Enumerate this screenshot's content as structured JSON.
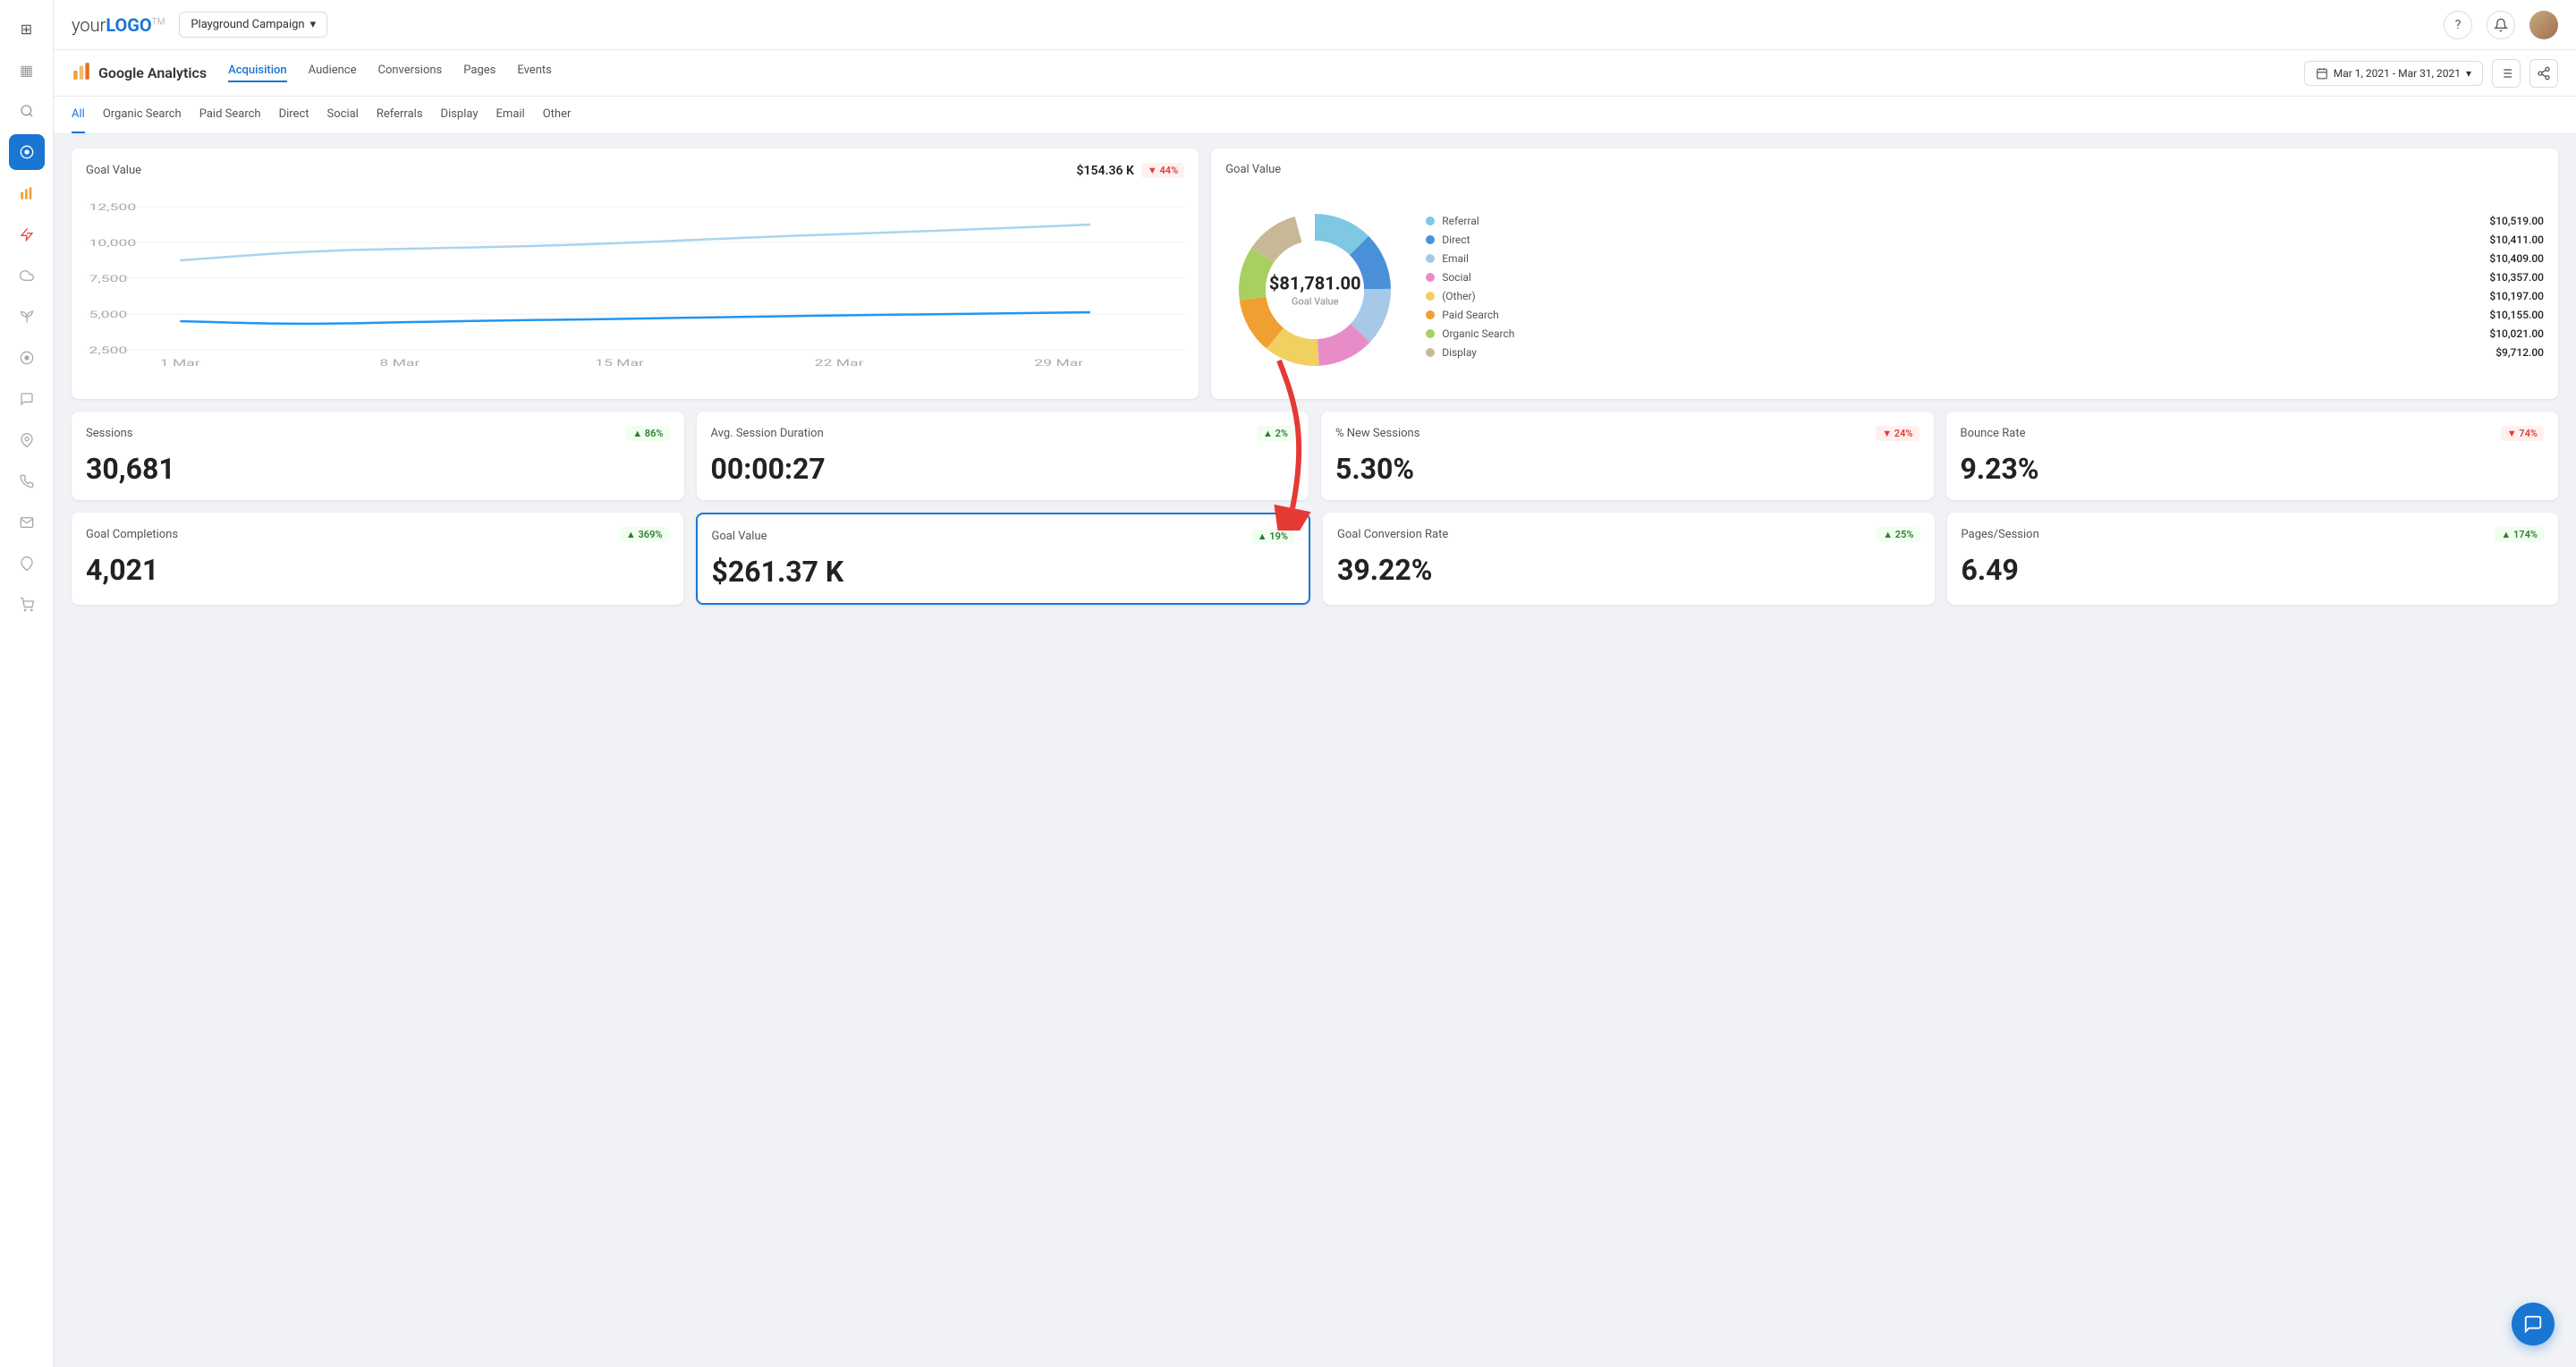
{
  "logo": {
    "text_plain": "your",
    "text_bold": "LOGO",
    "tm": "TM"
  },
  "header": {
    "campaign_label": "Playground Campaign",
    "campaign_dropdown_icon": "▾",
    "help_icon": "?",
    "notification_icon": "🔔",
    "date_range": "Mar 1, 2021 - Mar 31, 2021"
  },
  "ga": {
    "title": "Google Analytics",
    "tabs": [
      {
        "label": "Acquisition",
        "active": true
      },
      {
        "label": "Audience",
        "active": false
      },
      {
        "label": "Conversions",
        "active": false
      },
      {
        "label": "Pages",
        "active": false
      },
      {
        "label": "Events",
        "active": false
      }
    ]
  },
  "channel_tabs": [
    {
      "label": "All",
      "active": true
    },
    {
      "label": "Organic Search",
      "active": false
    },
    {
      "label": "Paid Search",
      "active": false
    },
    {
      "label": "Direct",
      "active": false
    },
    {
      "label": "Social",
      "active": false
    },
    {
      "label": "Referrals",
      "active": false
    },
    {
      "label": "Display",
      "active": false
    },
    {
      "label": "Email",
      "active": false
    },
    {
      "label": "Other",
      "active": false
    }
  ],
  "goal_value_chart": {
    "title": "Goal Value",
    "value": "$154.36 K",
    "badge": "▼ 44%",
    "badge_type": "red",
    "x_labels": [
      "1 Mar",
      "8 Mar",
      "15 Mar",
      "22 Mar",
      "29 Mar"
    ],
    "y_labels": [
      "12,500",
      "10,000",
      "7,500",
      "5,000",
      "2,500"
    ]
  },
  "donut_chart": {
    "title": "Goal Value",
    "center_value": "$81,781.00",
    "center_label": "Goal Value",
    "legend": [
      {
        "name": "Referral",
        "value": "$10,519.00",
        "color": "#7ec8e3"
      },
      {
        "name": "Direct",
        "value": "$10,411.00",
        "color": "#4a90d9"
      },
      {
        "name": "Email",
        "value": "$10,409.00",
        "color": "#a8c8e8"
      },
      {
        "name": "Social",
        "value": "$10,357.00",
        "color": "#e88cc8"
      },
      {
        "name": "(Other)",
        "value": "$10,197.00",
        "color": "#f0d060"
      },
      {
        "name": "Paid Search",
        "value": "$10,155.00",
        "color": "#f0a030"
      },
      {
        "name": "Organic Search",
        "value": "$10,021.00",
        "color": "#a8d060"
      },
      {
        "name": "Display",
        "value": "$9,712.00",
        "color": "#c8b898"
      }
    ]
  },
  "metrics": [
    {
      "label": "Sessions",
      "value": "30,681",
      "badge": "▲ 86%",
      "badge_type": "green",
      "highlighted": false
    },
    {
      "label": "Avg. Session Duration",
      "value": "00:00:27",
      "badge": "▲ 2%",
      "badge_type": "green",
      "highlighted": false
    },
    {
      "label": "% New Sessions",
      "value": "5.30%",
      "badge": "▼ 24%",
      "badge_type": "red",
      "highlighted": false
    },
    {
      "label": "Bounce Rate",
      "value": "9.23%",
      "badge": "▼ 74%",
      "badge_type": "red",
      "highlighted": false
    }
  ],
  "metrics2": [
    {
      "label": "Goal Completions",
      "value": "4,021",
      "badge": "▲ 369%",
      "badge_type": "green",
      "highlighted": false
    },
    {
      "label": "Goal Value",
      "value": "$261.37 K",
      "badge": "▲ 19%",
      "badge_type": "green",
      "highlighted": true
    },
    {
      "label": "Goal Conversion Rate",
      "value": "39.22%",
      "badge": "▲ 25%",
      "badge_type": "green",
      "highlighted": false
    },
    {
      "label": "Pages/Session",
      "value": "6.49",
      "badge": "▲ 174%",
      "badge_type": "green",
      "highlighted": false
    }
  ],
  "nav_icons": [
    {
      "name": "home",
      "icon": "⊞"
    },
    {
      "name": "grid",
      "icon": "▦"
    },
    {
      "name": "search",
      "icon": "🔍"
    },
    {
      "name": "analytics-circle",
      "icon": "◉"
    },
    {
      "name": "bar-chart",
      "icon": "📊"
    },
    {
      "name": "lightning",
      "icon": "⚡"
    },
    {
      "name": "cloud",
      "icon": "☁"
    },
    {
      "name": "sprout",
      "icon": "🌱"
    },
    {
      "name": "circle-dot",
      "icon": "⊙"
    },
    {
      "name": "chat",
      "icon": "💬"
    },
    {
      "name": "pin",
      "icon": "📌"
    },
    {
      "name": "phone",
      "icon": "📞"
    },
    {
      "name": "mail",
      "icon": "✉"
    },
    {
      "name": "location",
      "icon": "📍"
    },
    {
      "name": "cart",
      "icon": "🛒"
    }
  ]
}
